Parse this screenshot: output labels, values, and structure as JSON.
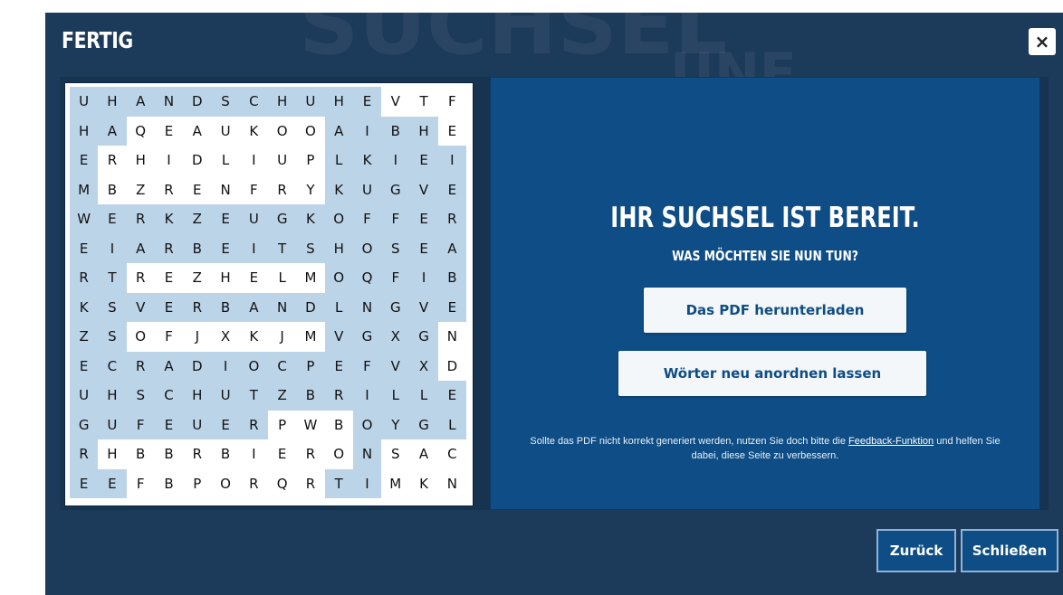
{
  "dialog": {
    "title": "FERTIG",
    "close_glyph": "×",
    "background_words": [
      "SUCHSEL",
      "UNE"
    ]
  },
  "puzzle": {
    "rows": [
      "UHANDSCHUHEVTF",
      "HAQEAUKOOAIBHE",
      "ERHIDLIUPLKIEI",
      "MBZRENFRYKUGVE",
      "WERKZEUGKOFFER",
      "EIARBEITSHOSEA",
      "RTREZHELMOQFIB",
      "KSVERBANDLNGVE",
      "ZSOFJXKJMVGXGN",
      "ECRADIOCPEFVXD",
      "UHSCHUTZBRILLE",
      "GUFEUERPWBOYGL",
      "RHBBRBIERONSAC",
      "EEFBPORQRTIMKN"
    ],
    "highlighted_rows": [
      "11111111111000",
      "11000000011110",
      "10000000011111",
      "10000000011111",
      "11111111111111",
      "11111111111111",
      "11000000011111",
      "11111111111111",
      "11000000011110",
      "11111111111110",
      "11111111111111",
      "11111110001111",
      "10000000001000",
      "11000000011000"
    ],
    "highlight_color": "#bcd4e8"
  },
  "info": {
    "heading": "IHR SUCHSEL IST BEREIT.",
    "subheading": "WAS MÖCHTEN SIE NUN TUN?",
    "download_label": "Das PDF herunterladen",
    "rearrange_label": "Wörter neu anordnen lassen",
    "note_before_link": "Sollte das PDF nicht korrekt generiert werden, nutzen Sie doch bitte die ",
    "note_link": "Feedback-Funktion",
    "note_after_link": " und helfen Sie dabei, diese Seite zu verbessern."
  },
  "footer": {
    "back_label": "Zurück",
    "close_label": "Schließen"
  },
  "colors": {
    "dialog_bg": "#1c3a5a",
    "info_bg": "#0e4d85",
    "button_text": "#0e4d85"
  }
}
